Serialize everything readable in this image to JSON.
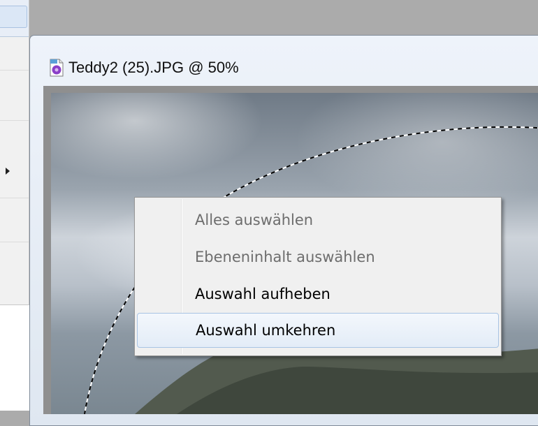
{
  "document": {
    "title": "Teddy2 (25).JPG @ 50%",
    "icon": "jpg-file-icon"
  },
  "background_menu": {
    "submenu_arrow_icon": "submenu-arrow-icon"
  },
  "context_menu": {
    "items": [
      {
        "label": "Alles auswählen",
        "enabled": false
      },
      {
        "label": "Ebeneninhalt auswählen",
        "enabled": false
      },
      {
        "label": "Auswahl aufheben",
        "enabled": true
      },
      {
        "label": "Auswahl umkehren",
        "enabled": true,
        "highlighted": true
      }
    ]
  },
  "colors": {
    "menu_background": "#f0f0f0",
    "highlight_border": "#a8c3e3",
    "disabled_text": "#6d6d6d"
  }
}
